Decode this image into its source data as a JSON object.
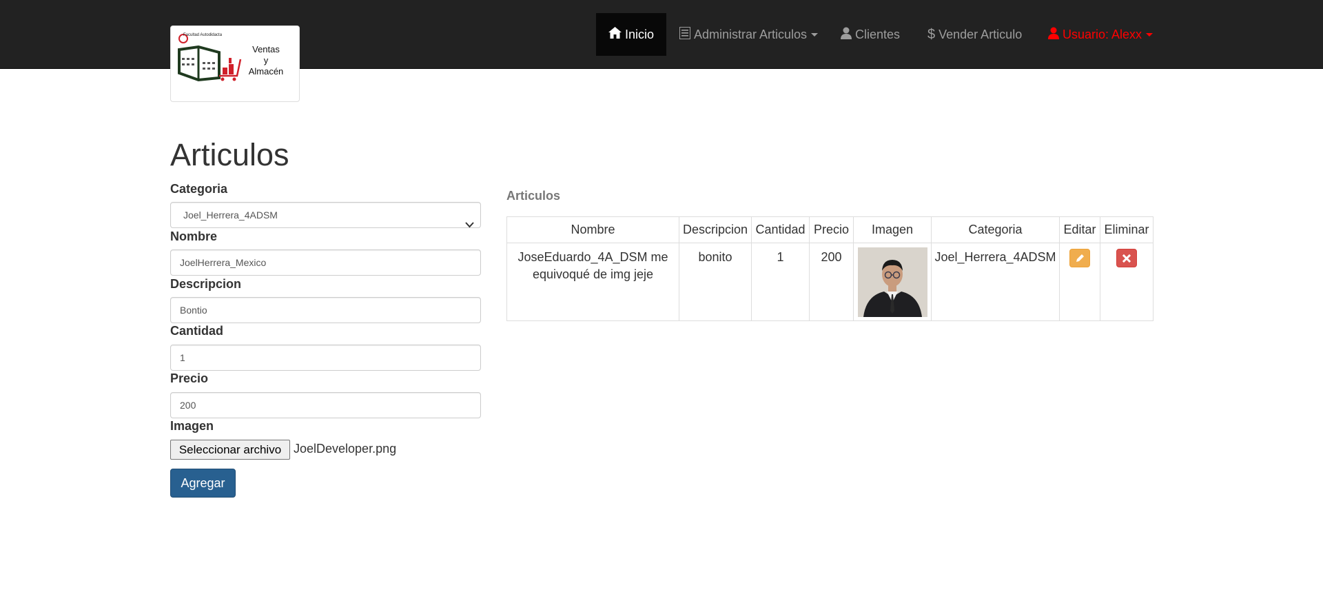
{
  "nav": {
    "home": "Inicio",
    "manage_articles": "Administrar Articulos",
    "clients": "Clientes",
    "sell": "Vender Articulo",
    "user": "Usuario: Alexx"
  },
  "brand": {
    "line1": "Ventas",
    "line2": "y",
    "line3": "Almacén",
    "small_text": "Facultad Autodidacta"
  },
  "page": {
    "title": "Articulos"
  },
  "form": {
    "categoria_label": "Categoria",
    "categoria_value": "Joel_Herrera_4ADSM",
    "nombre_label": "Nombre",
    "nombre_value": "JoelHerrera_Mexico",
    "descripcion_label": "Descripcion",
    "descripcion_value": "Bontio",
    "cantidad_label": "Cantidad",
    "cantidad_value": "1",
    "precio_label": "Precio",
    "precio_value": "200",
    "imagen_label": "Imagen",
    "file_button": "Seleccionar archivo",
    "file_name": "JoelDeveloper.png",
    "submit": "Agregar"
  },
  "table": {
    "title": "Articulos",
    "headers": [
      "Nombre",
      "Descripcion",
      "Cantidad",
      "Precio",
      "Imagen",
      "Categoria",
      "Editar",
      "Eliminar"
    ],
    "rows": [
      {
        "nombre": "JoseEduardo_4A_DSM me equivoqué de img jeje",
        "descripcion": "bonito",
        "cantidad": "1",
        "precio": "200",
        "categoria": "Joel_Herrera_4ADSM"
      }
    ]
  },
  "colors": {
    "navbar": "#222222",
    "active_nav": "#080808",
    "user_link": "#ff0000",
    "primary_button": "#286090",
    "edit_button": "#f0ad4e",
    "delete_button": "#d9534f"
  },
  "icons": {
    "home": "home-icon",
    "list": "list-icon",
    "user": "user-icon",
    "dollar": "dollar-icon",
    "pencil": "pencil-icon",
    "remove": "remove-icon"
  }
}
